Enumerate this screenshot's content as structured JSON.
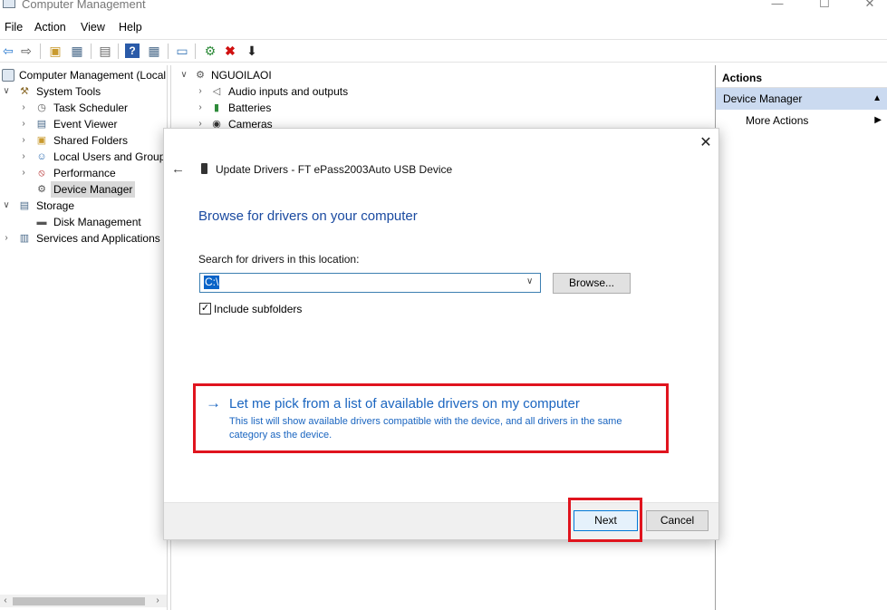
{
  "window": {
    "title": "Computer Management",
    "controls": {
      "minimize": "—",
      "maximize": "☐",
      "close": "✕"
    }
  },
  "menu": [
    "File",
    "Action",
    "View",
    "Help"
  ],
  "toolbar_icons": [
    "back-arrow-icon",
    "forward-arrow-icon",
    "up-folder-icon",
    "show-hide-tree-icon",
    "properties-icon",
    "help-icon",
    "show-hide-action-pane-icon",
    "monitor-icon",
    "scan-hardware-icon",
    "uninstall-device-icon",
    "update-driver-icon"
  ],
  "tree": {
    "root": "Computer Management (Local",
    "system_tools": "System Tools",
    "task_scheduler": "Task Scheduler",
    "event_viewer": "Event Viewer",
    "shared_folders": "Shared Folders",
    "local_users": "Local Users and Groups",
    "performance": "Performance",
    "device_manager": "Device Manager",
    "storage": "Storage",
    "disk_management": "Disk Management",
    "services_apps": "Services and Applications"
  },
  "devices": {
    "computer": "NGUOILAOI",
    "audio": "Audio inputs and outputs",
    "batteries": "Batteries",
    "cameras": "Cameras"
  },
  "actions": {
    "header": "Actions",
    "section": "Device Manager",
    "more": "More Actions"
  },
  "dialog": {
    "title": "Update Drivers - FT ePass2003Auto USB Device",
    "heading": "Browse for drivers on your computer",
    "search_label": "Search for drivers in this location:",
    "path_value": "C:\\",
    "browse_label": "Browse...",
    "include_subfolders_label": "Include subfolders",
    "include_subfolders_checked": true,
    "pick_title": "Let me pick from a list of available drivers on my computer",
    "pick_desc": "This list will show available drivers compatible with the device, and all drivers in the same category as the device.",
    "next_label": "Next",
    "cancel_label": "Cancel"
  },
  "colors": {
    "link_blue": "#1a65c0",
    "heading_blue": "#1a4aa0",
    "highlight_red": "#e0141e",
    "action_section_bg": "#cbdaf0"
  }
}
